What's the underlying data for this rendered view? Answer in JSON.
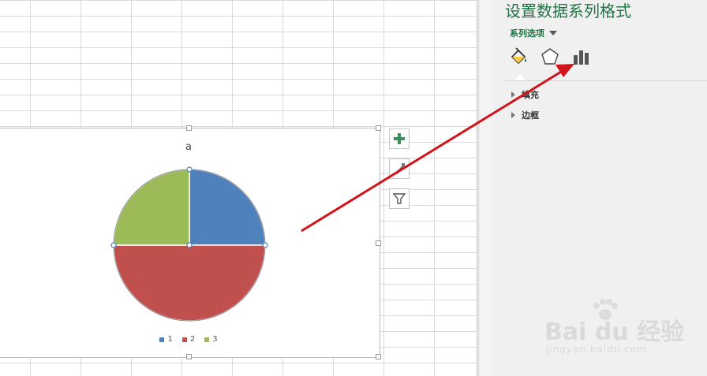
{
  "panel": {
    "title": "设置数据系列格式",
    "series_options_label": "系列选项",
    "tab_icons": [
      "paint-bucket-icon",
      "pentagon-icon",
      "bar-chart-icon"
    ],
    "sections": [
      {
        "label": "填充"
      },
      {
        "label": "边框"
      }
    ]
  },
  "chart": {
    "title": "a",
    "side_buttons": [
      "chart-elements-plus-icon",
      "chart-styles-brush-icon",
      "chart-filter-icon"
    ]
  },
  "chart_data": {
    "type": "pie",
    "title": "a",
    "categories": [
      "1",
      "2",
      "3"
    ],
    "values": [
      25,
      50,
      25
    ],
    "colors": [
      "#4f81bd",
      "#c0504d",
      "#9bbb59"
    ],
    "legend_position": "bottom"
  },
  "watermark": {
    "brand": "Bai du 经验",
    "url": "jingyan.baidu.com"
  },
  "annotation": {
    "arrow_color": "#d0141a"
  }
}
